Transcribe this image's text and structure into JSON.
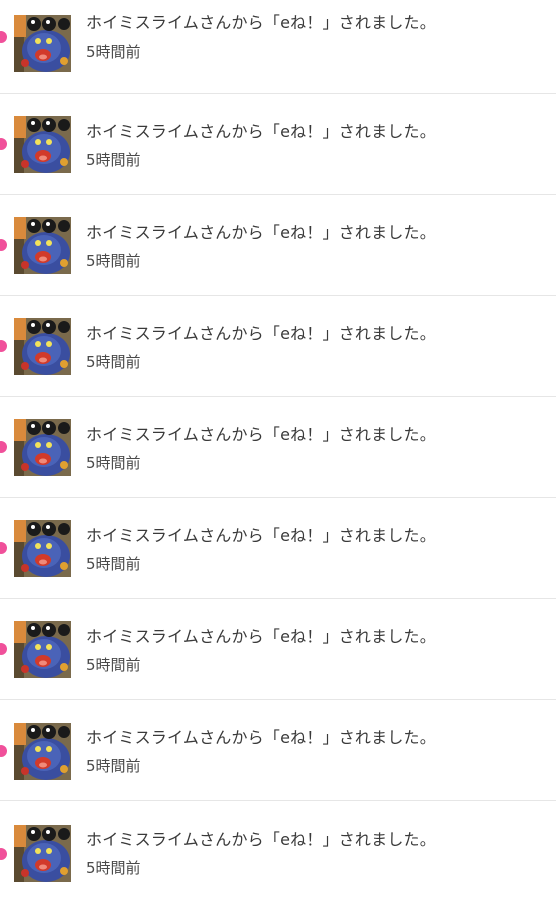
{
  "notifications": [
    {
      "message": "ホイミスライムさんから「eね！」されました。",
      "time": "5時間前",
      "unread": true,
      "avatar_icon": "hoimi-slime-avatar"
    },
    {
      "message": "ホイミスライムさんから「eね！」されました。",
      "time": "5時間前",
      "unread": true,
      "avatar_icon": "hoimi-slime-avatar"
    },
    {
      "message": "ホイミスライムさんから「eね！」されました。",
      "time": "5時間前",
      "unread": true,
      "avatar_icon": "hoimi-slime-avatar"
    },
    {
      "message": "ホイミスライムさんから「eね！」されました。",
      "time": "5時間前",
      "unread": true,
      "avatar_icon": "hoimi-slime-avatar"
    },
    {
      "message": "ホイミスライムさんから「eね！」されました。",
      "time": "5時間前",
      "unread": true,
      "avatar_icon": "hoimi-slime-avatar"
    },
    {
      "message": "ホイミスライムさんから「eね！」されました。",
      "time": "5時間前",
      "unread": true,
      "avatar_icon": "hoimi-slime-avatar"
    },
    {
      "message": "ホイミスライムさんから「eね！」されました。",
      "time": "5時間前",
      "unread": true,
      "avatar_icon": "hoimi-slime-avatar"
    },
    {
      "message": "ホイミスライムさんから「eね！」されました。",
      "time": "5時間前",
      "unread": true,
      "avatar_icon": "hoimi-slime-avatar"
    },
    {
      "message": "ホイミスライムさんから「eね！」されました。",
      "time": "5時間前",
      "unread": true,
      "avatar_icon": "hoimi-slime-avatar"
    }
  ],
  "colors": {
    "unread_dot": "#f0509a",
    "message_text": "#3a3a3a",
    "time_text": "#4a4a4a",
    "divider": "#e6e6e6"
  }
}
